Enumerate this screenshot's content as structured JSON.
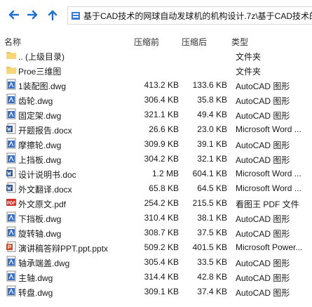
{
  "address": {
    "path": "基于CAD技术的网球自动发球机的机构设计.7z\\基于CAD技术的"
  },
  "columns": {
    "name": "名称",
    "size": "压缩前",
    "packed": "压缩后",
    "type": "类型"
  },
  "colors": {
    "folder": "#f2c14e",
    "dwg": "#3b6fc4",
    "doc": "#2b5797",
    "pdf": "#d0352b",
    "ppt": "#d24726",
    "accent": "#1f6fd1"
  },
  "rows": [
    {
      "name": ".. (上级目录)",
      "size": "",
      "packed": "",
      "type": "文件夹",
      "icon": "folder-icon"
    },
    {
      "name": "Proe三维图",
      "size": "",
      "packed": "",
      "type": "文件夹",
      "icon": "folder-icon"
    },
    {
      "name": "1装配图.dwg",
      "size": "413.2 KB",
      "packed": "133.6 KB",
      "type": "AutoCAD 图形",
      "icon": "dwg-icon"
    },
    {
      "name": "齿轮.dwg",
      "size": "306.4 KB",
      "packed": "35.8 KB",
      "type": "AutoCAD 图形",
      "icon": "dwg-icon"
    },
    {
      "name": "固定架.dwg",
      "size": "321.1 KB",
      "packed": "49.4 KB",
      "type": "AutoCAD 图形",
      "icon": "dwg-icon"
    },
    {
      "name": "开题报告.docx",
      "size": "26.6 KB",
      "packed": "23.0 KB",
      "type": "Microsoft Word ...",
      "icon": "word-icon"
    },
    {
      "name": "摩擦轮.dwg",
      "size": "309.9 KB",
      "packed": "39.1 KB",
      "type": "AutoCAD 图形",
      "icon": "dwg-icon"
    },
    {
      "name": "上挡板.dwg",
      "size": "304.2 KB",
      "packed": "32.1 KB",
      "type": "AutoCAD 图形",
      "icon": "dwg-icon"
    },
    {
      "name": "设计说明书.doc",
      "size": "1.2 MB",
      "packed": "604.1 KB",
      "type": "Microsoft Word ...",
      "icon": "word-icon"
    },
    {
      "name": "外文翻译.docx",
      "size": "65.8 KB",
      "packed": "64.5 KB",
      "type": "Microsoft Word ...",
      "icon": "word-icon"
    },
    {
      "name": "外文原文.pdf",
      "size": "254.2 KB",
      "packed": "215.5 KB",
      "type": "看图王 PDF 文件",
      "icon": "pdf-icon"
    },
    {
      "name": "下挡板.dwg",
      "size": "310.4 KB",
      "packed": "38.1 KB",
      "type": "AutoCAD 图形",
      "icon": "dwg-icon"
    },
    {
      "name": "旋转轴.dwg",
      "size": "308.7 KB",
      "packed": "37.5 KB",
      "type": "AutoCAD 图形",
      "icon": "dwg-icon"
    },
    {
      "name": "演讲稿答辩PPT.ppt.pptx",
      "size": "509.2 KB",
      "packed": "401.5 KB",
      "type": "Microsoft Power...",
      "icon": "ppt-icon"
    },
    {
      "name": "轴承端盖.dwg",
      "size": "305.4 KB",
      "packed": "33.5 KB",
      "type": "AutoCAD 图形",
      "icon": "dwg-icon"
    },
    {
      "name": "主轴.dwg",
      "size": "314.4 KB",
      "packed": "42.8 KB",
      "type": "AutoCAD 图形",
      "icon": "dwg-icon"
    },
    {
      "name": "转盘.dwg",
      "size": "309.1 KB",
      "packed": "37.4 KB",
      "type": "AutoCAD 图形",
      "icon": "dwg-icon"
    }
  ]
}
